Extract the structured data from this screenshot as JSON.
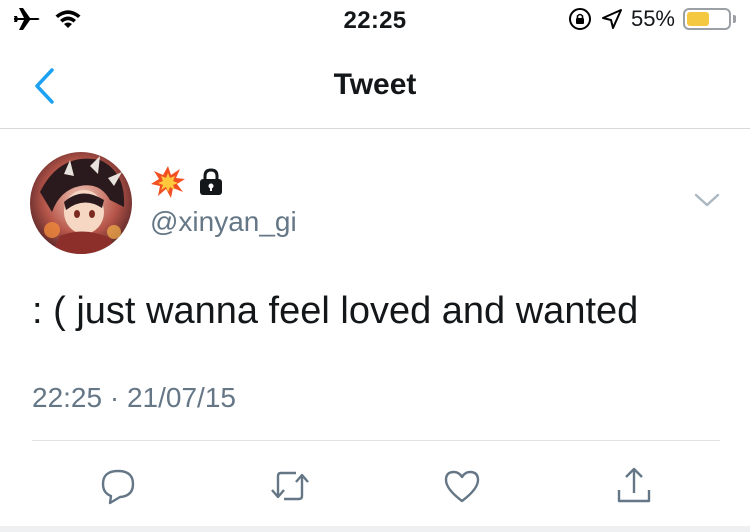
{
  "status_bar": {
    "time": "22:25",
    "battery_percent": "55%",
    "battery_level": 0.55,
    "icons": [
      "airplane-icon",
      "wifi-icon",
      "orientation-lock-icon",
      "location-icon",
      "battery-icon"
    ]
  },
  "nav": {
    "title": "Tweet",
    "back_icon": "chevron-left-icon"
  },
  "tweet": {
    "display_name_icons": [
      "collision-emoji-icon",
      "lock-icon"
    ],
    "handle": "@xinyan_gi",
    "text": ":  ( just wanna feel loved and wanted",
    "time": "22:25",
    "separator": "·",
    "date": "21/07/15"
  },
  "actions": [
    "reply-icon",
    "retweet-icon",
    "like-icon",
    "share-icon"
  ],
  "colors": {
    "accent": "#1da1f2",
    "muted": "#657786",
    "text": "#14171a",
    "battery_fill": "#f5c842"
  }
}
